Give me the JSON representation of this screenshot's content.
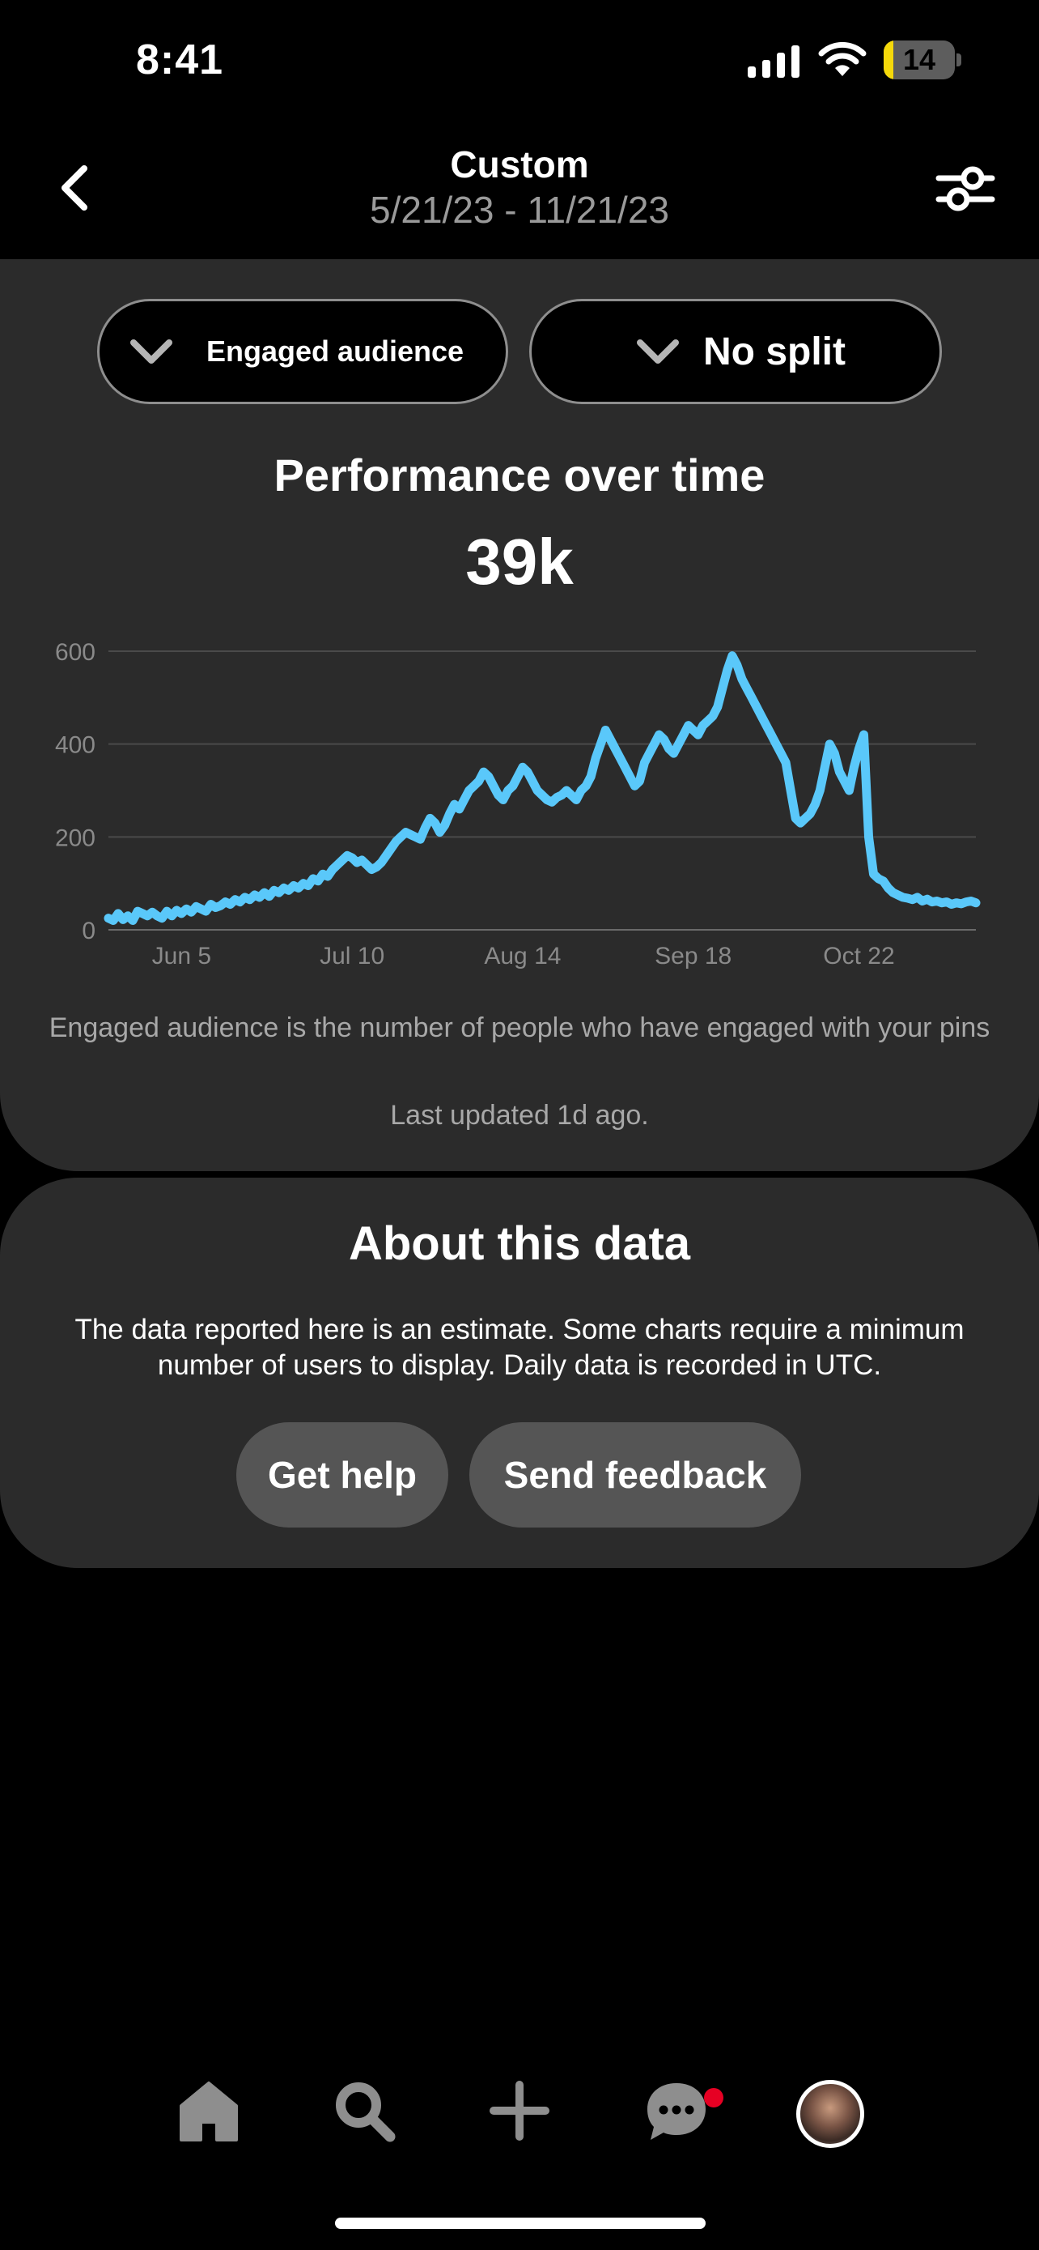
{
  "status_bar": {
    "time": "8:41",
    "battery": "14",
    "battery_level": 0.14
  },
  "header": {
    "title": "Custom",
    "date_range": "5/21/23 - 11/21/23"
  },
  "filters": {
    "metric": "Engaged audience",
    "split": "No split"
  },
  "performance": {
    "title": "Performance over time",
    "total": "39k"
  },
  "chart_data": {
    "type": "line",
    "ylim": [
      0,
      600
    ],
    "y_ticks": [
      "0",
      "200",
      "400",
      "600"
    ],
    "x_ticks": [
      "Jun 5",
      "Jul 10",
      "Aug 14",
      "Sep 18",
      "Oct 22"
    ],
    "x_tick_index": [
      15,
      50,
      85,
      120,
      154
    ],
    "grid": true,
    "color": "#5ac8fa",
    "values": [
      25,
      20,
      35,
      22,
      30,
      20,
      40,
      35,
      30,
      38,
      30,
      25,
      40,
      30,
      42,
      35,
      45,
      38,
      50,
      45,
      40,
      55,
      48,
      52,
      60,
      55,
      65,
      60,
      70,
      65,
      75,
      70,
      80,
      72,
      85,
      80,
      90,
      85,
      95,
      90,
      100,
      95,
      110,
      105,
      120,
      115,
      130,
      140,
      150,
      160,
      155,
      145,
      150,
      140,
      130,
      135,
      145,
      160,
      175,
      190,
      200,
      210,
      205,
      200,
      195,
      220,
      240,
      230,
      210,
      225,
      250,
      270,
      260,
      280,
      300,
      310,
      320,
      340,
      330,
      310,
      290,
      280,
      300,
      310,
      330,
      350,
      340,
      320,
      300,
      290,
      280,
      275,
      285,
      290,
      300,
      290,
      280,
      300,
      310,
      330,
      370,
      400,
      430,
      410,
      390,
      370,
      350,
      330,
      310,
      320,
      360,
      380,
      400,
      420,
      410,
      390,
      380,
      400,
      420,
      440,
      430,
      420,
      440,
      450,
      460,
      480,
      520,
      560,
      590,
      570,
      540,
      520,
      500,
      480,
      460,
      440,
      420,
      400,
      380,
      360,
      300,
      240,
      230,
      240,
      250,
      270,
      300,
      350,
      400,
      380,
      340,
      320,
      300,
      350,
      390,
      420,
      200,
      120,
      110,
      105,
      90,
      80,
      75,
      70,
      68,
      65,
      70,
      62,
      66,
      60,
      62,
      58,
      60,
      55,
      58,
      56,
      60,
      62,
      58
    ]
  },
  "chart_desc": "Engaged audience is the number of people who have engaged with your pins",
  "last_updated": "Last updated 1d ago.",
  "about": {
    "title": "About this data",
    "text": "The data reported here is an estimate. Some charts require a minimum number of users to display. Daily data is recorded in UTC.",
    "help_label": "Get help",
    "feedback_label": "Send feedback"
  },
  "icons": {
    "back": "chevron-left-icon",
    "filter": "sliders-icon",
    "dropdown": "chevron-down-icon",
    "tabs": [
      "home-icon",
      "search-icon",
      "plus-icon",
      "messages-icon",
      "profile-avatar"
    ]
  },
  "colors": {
    "line": "#5ac8fa",
    "card": "#2b2b2b",
    "notification": "#e60023",
    "battery": "#f5d90a"
  }
}
